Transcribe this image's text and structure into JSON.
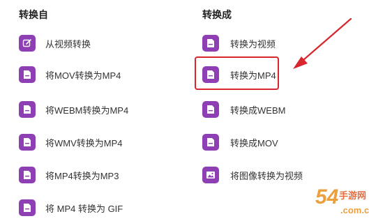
{
  "left_column": {
    "title": "转换自",
    "items": [
      {
        "label": "从视频转换",
        "icon": "edit-icon"
      },
      {
        "label": "将MOV转换为MP4",
        "icon": "file-icon"
      },
      {
        "label": "将WEBM转换为MP4",
        "icon": "file-icon"
      },
      {
        "label": "将WMV转换为MP4",
        "icon": "file-icon"
      },
      {
        "label": "将MP4转换为MP3",
        "icon": "file-icon"
      },
      {
        "label": "将 MP4 转换为 GIF",
        "icon": "file-icon"
      }
    ]
  },
  "right_column": {
    "title": "转换成",
    "items": [
      {
        "label": "转换为视频",
        "icon": "file-icon"
      },
      {
        "label": "转换为MP4",
        "icon": "file-icon",
        "highlighted": true
      },
      {
        "label": "转换成WEBM",
        "icon": "file-icon"
      },
      {
        "label": "转换成MOV",
        "icon": "file-icon"
      },
      {
        "label": "将图像转换为视频",
        "icon": "image-icon"
      }
    ]
  },
  "watermark": {
    "digits": "54",
    "logo_text": "手游网",
    "domain": ".com.cn"
  },
  "colors": {
    "icon_bg": "#8d3fb3",
    "highlight": "#d8262e",
    "watermark": "#e8901c"
  }
}
